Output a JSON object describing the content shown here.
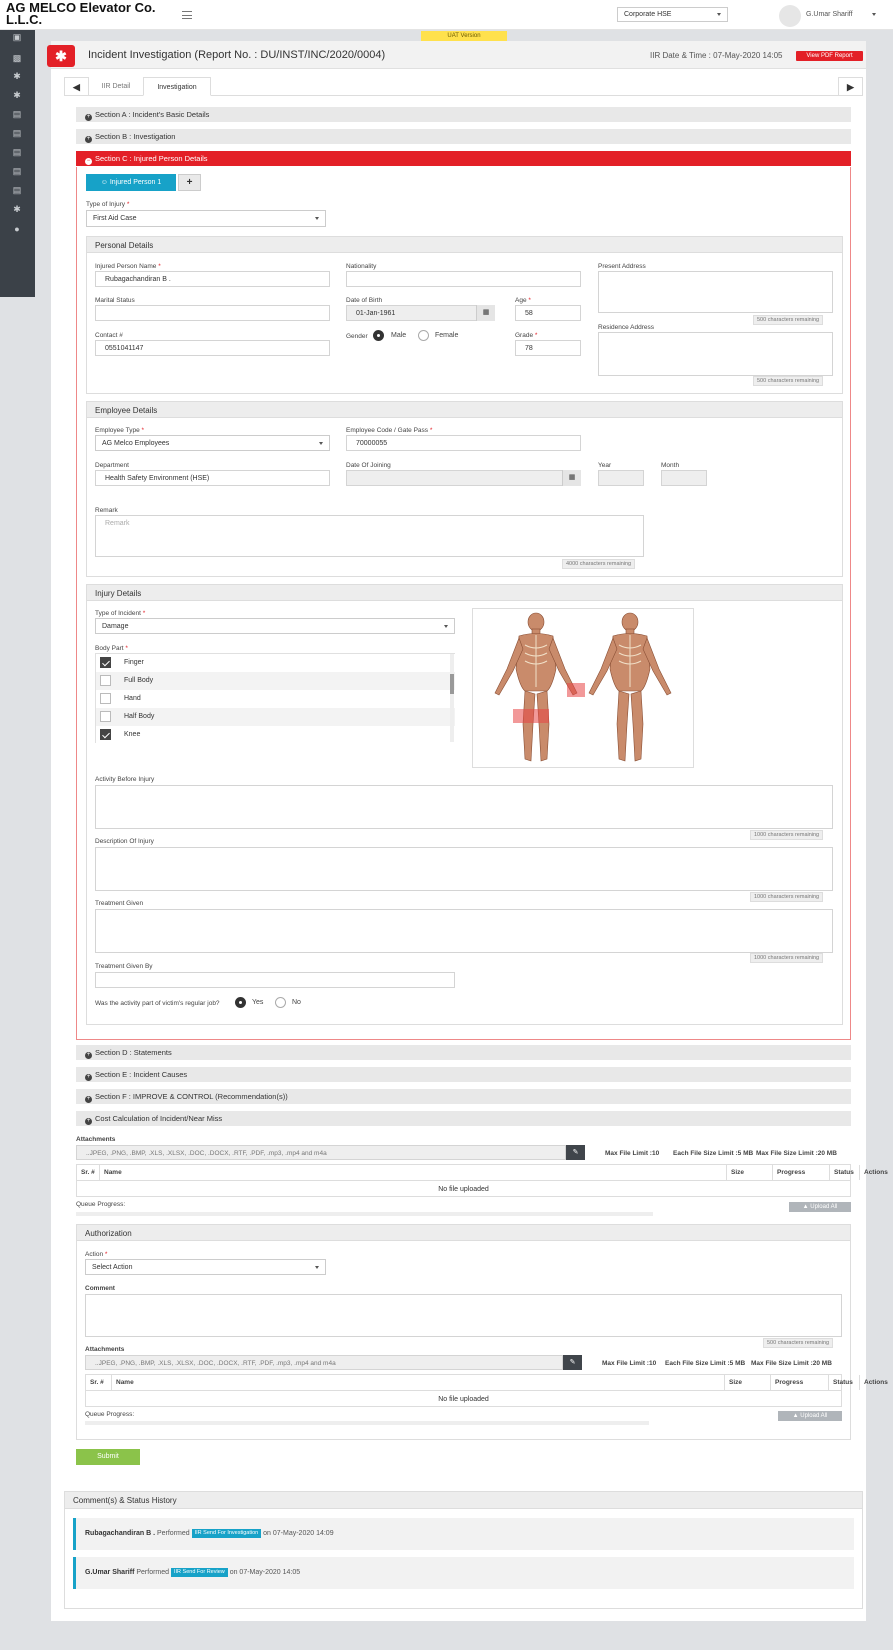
{
  "header": {
    "brand": "AG MELCO Elevator Co. L.L.C.",
    "role_select": "Corporate HSE",
    "user_name": "G.Umar Shariff",
    "uat_label": "UAT Version"
  },
  "page": {
    "title": "Incident Investigation (Report No. : DU/INST/INC/2020/0004)",
    "datetime": "IIR Date & Time : 07-May-2020 14:05",
    "pdf_button": "View PDF Report",
    "tabs": [
      "IIR Detail",
      "Investigation"
    ],
    "active_tab": "Investigation"
  },
  "sections": {
    "a": "Section A : Incident's Basic Details",
    "b": "Section B : Investigation",
    "c": "Section C : Injured Person Details",
    "d": "Section D : Statements",
    "e": "Section E : Incident Causes",
    "f": "Section F : IMPROVE & CONTROL (Recommendation(s))",
    "g": "Cost Calculation of Incident/Near Miss"
  },
  "injured": {
    "tab_label": "Injured Person 1",
    "type_of_injury_label": "Type of Injury",
    "type_of_injury": "First Aid Case",
    "personal": {
      "heading": "Personal Details",
      "name_label": "Injured Person Name",
      "name": "Rubagachandiran B .",
      "nationality_label": "Nationality",
      "nationality": "",
      "present_address_label": "Present Address",
      "marital_label": "Marital Status",
      "marital": "",
      "dob_label": "Date of Birth",
      "dob": "01-Jan-1961",
      "age_label": "Age",
      "age": "58",
      "contact_label": "Contact #",
      "contact": "0551041147",
      "gender_label": "Gender",
      "male": "Male",
      "female": "Female",
      "grade_label": "Grade",
      "grade": "78",
      "residence_address_label": "Residence Address",
      "chars_500": "500 characters remaining"
    },
    "employee": {
      "heading": "Employee Details",
      "type_label": "Employee Type",
      "type": "AG Melco Employees",
      "code_label": "Employee Code / Gate Pass",
      "code": "70000055",
      "dept_label": "Department",
      "dept": "Health Safety Environment (HSE)",
      "doj_label": "Date Of Joining",
      "year_label": "Year",
      "month_label": "Month",
      "remark_label": "Remark",
      "remark_placeholder": "Remark",
      "chars_4000": "4000 characters remaining"
    },
    "injury": {
      "heading": "Injury Details",
      "incident_type_label": "Type of Incident",
      "incident_type": "Damage",
      "body_part_label": "Body Part",
      "body_parts": [
        {
          "name": "Finger",
          "checked": true
        },
        {
          "name": "Full Body",
          "checked": false
        },
        {
          "name": "Hand",
          "checked": false
        },
        {
          "name": "Half Body",
          "checked": false
        },
        {
          "name": "Knee",
          "checked": true
        }
      ],
      "activity_label": "Activity Before Injury",
      "description_label": "Description Of Injury",
      "treatment_label": "Treatment Given",
      "treatment_by_label": "Treatment Given By",
      "chars_1000": "1000 characters remaining",
      "regular_job_label": "Was the activity part of victim's regular job?",
      "yes": "Yes",
      "no": "No"
    }
  },
  "attachments": {
    "label": "Attachments",
    "placeholder": "..JPEG, .PNG, .BMP, .XLS, .XLSX, .DOC, .DOCX, .RTF, .PDF, .mp3, .mp4 and m4a",
    "max_file": "Max File Limit :10",
    "each_size": "Each File Size Limit :5 MB",
    "max_size": "Max File Size Limit :20 MB",
    "columns": [
      "Sr. #",
      "Name",
      "Size",
      "Progress",
      "Status",
      "Actions"
    ],
    "empty": "No file uploaded",
    "queue": "Queue Progress:",
    "upload_all": "Upload All"
  },
  "authorization": {
    "heading": "Authorization",
    "action_label": "Action",
    "action": "Select Action",
    "comment_label": "Comment",
    "chars_500": "500 characters remaining"
  },
  "submit": "Submit",
  "history": {
    "heading": "Comment(s) & Status History",
    "items": [
      {
        "name": "Rubagachandiran B .",
        "verb": "Performed",
        "badge": "IIR Send For Investigation",
        "when": "on 07-May-2020 14:09"
      },
      {
        "name": "G.Umar Shariff",
        "verb": "Performed",
        "badge": "IIR Send For Review",
        "when": "on 07-May-2020 14:05"
      }
    ]
  }
}
